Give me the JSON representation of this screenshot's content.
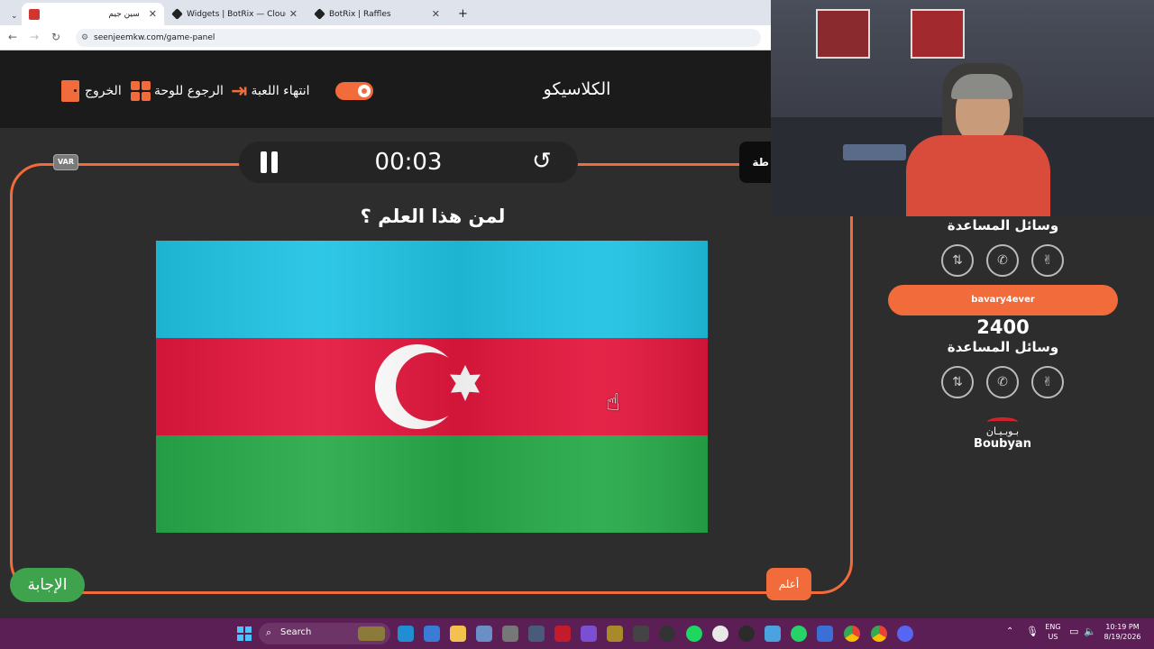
{
  "browser": {
    "tabs": [
      {
        "label": "سين جيم"
      },
      {
        "label": "Widgets | BotRix — Cloud Strea"
      },
      {
        "label": "BotRix | Raffles"
      }
    ],
    "new_tab": "+",
    "url": "seenjeemkw.com/game-panel"
  },
  "header": {
    "title": "الكلاسيكو",
    "end_game": "انتهاء اللعبة",
    "back_to_board": "الرجوع للوحة",
    "exit": "الخروج"
  },
  "timer": {
    "time": "00:03",
    "var_badge": "VAR"
  },
  "question": {
    "text": "لمن هذا العلم ؟"
  },
  "side": {
    "cut_label": "طة",
    "help_title_1": "وسائل المساعدة",
    "player_name": "bavary4ever",
    "score": "2400",
    "help_title_2": "وسائل المساعدة",
    "sponsor_ar": "بـوبـيـان",
    "sponsor_en": "Boubyan"
  },
  "buttons": {
    "answer": "الإجابة",
    "know": "أعلم"
  },
  "taskbar": {
    "search": "Search",
    "lang_top": "ENG",
    "lang_bottom": "US",
    "time": "10:19 PM",
    "date": "8/19/2026"
  },
  "colors": {
    "accent": "#f26b3a",
    "answer_green": "#3fa34d",
    "flag_blue": "#1fc3e3",
    "flag_red": "#e3173d",
    "flag_green": "#27a94a",
    "taskbar": "#5b1f55"
  }
}
